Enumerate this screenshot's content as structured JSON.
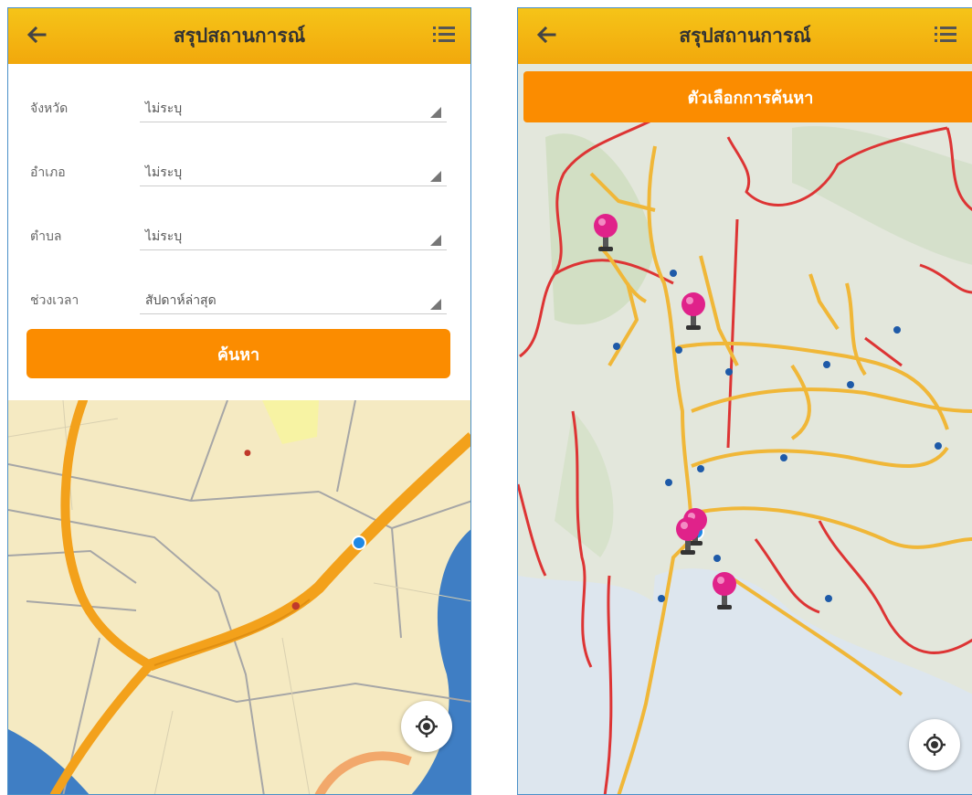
{
  "screen_left": {
    "header": {
      "title": "สรุปสถานการณ์",
      "back_icon": "arrow-left-icon",
      "menu_icon": "list-icon"
    },
    "form": {
      "fields": [
        {
          "label": "จังหวัด",
          "value": "ไม่ระบุ"
        },
        {
          "label": "อำเภอ",
          "value": "ไม่ระบุ"
        },
        {
          "label": "ตำบล",
          "value": "ไม่ระบุ"
        },
        {
          "label": "ช่วงเวลา",
          "value": "สัปดาห์ล่าสุด"
        }
      ],
      "search_label": "ค้นหา"
    },
    "map": {
      "locate_icon": "crosshair-icon"
    }
  },
  "screen_right": {
    "header": {
      "title": "สรุปสถานการณ์",
      "back_icon": "arrow-left-icon",
      "menu_icon": "list-icon"
    },
    "filter_label": "ตัวเลือกการค้นหา",
    "map": {
      "locate_icon": "crosshair-icon"
    }
  },
  "colors": {
    "header": "#f2b20f",
    "accent": "#fb8c00",
    "pin": "#e0228a",
    "location_dot": "#1e88e5"
  }
}
